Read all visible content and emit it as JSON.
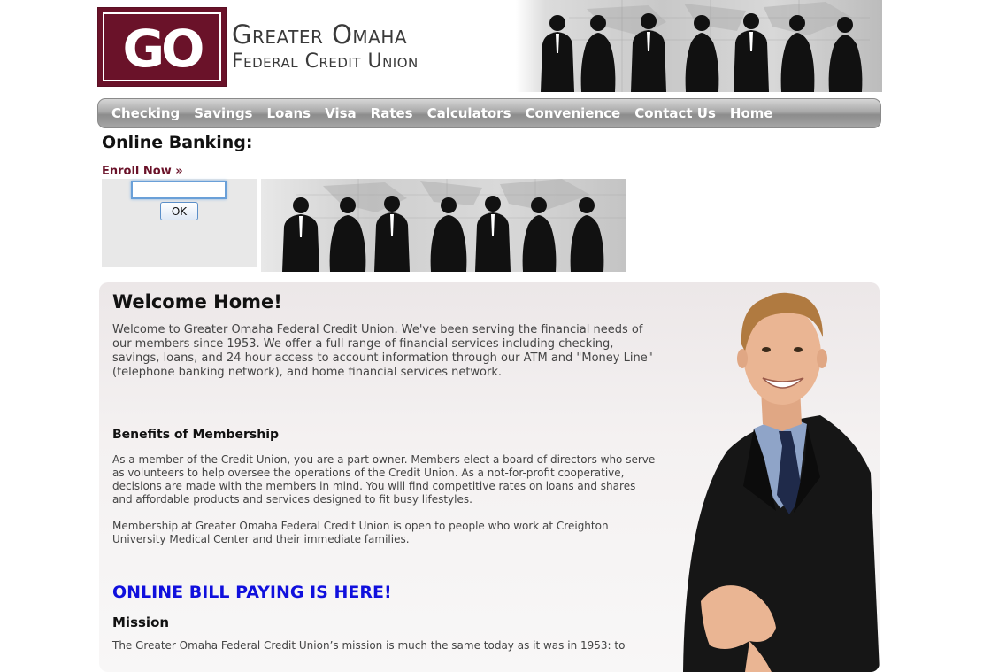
{
  "header": {
    "logo_letters": "GO",
    "brand_line1": "Greater Omaha",
    "brand_line2": "Federal Credit Union"
  },
  "nav": {
    "items": [
      {
        "label": "Checking"
      },
      {
        "label": "Savings"
      },
      {
        "label": "Loans"
      },
      {
        "label": "Visa"
      },
      {
        "label": "Rates"
      },
      {
        "label": "Calculators"
      },
      {
        "label": "Convenience"
      },
      {
        "label": "Contact Us"
      },
      {
        "label": "Home"
      }
    ]
  },
  "online_banking": {
    "title": "Online Banking:",
    "enroll_label": "Enroll Now »",
    "login_value": "",
    "ok_label": "OK"
  },
  "welcome": {
    "heading": "Welcome Home!",
    "intro": "Welcome to Greater Omaha Federal Credit Union. We've been serving the financial needs of our members since 1953. We offer a full range of financial services including checking, savings, loans, and 24 hour access to account information through our ATM and \"Money Line\" (telephone banking network), and home financial services network."
  },
  "benefits": {
    "heading": "Benefits of Membership",
    "para1": "As a member of the Credit Union, you are a part owner. Members elect a board of directors who serve as volunteers to help oversee the operations of the Credit Union. As a not-for-profit cooperative, decisions are made with the members in mind. You will find competitive rates on loans and shares and affordable products and services designed to fit busy lifestyles.",
    "para2": "Membership at Greater Omaha Federal Credit Union is open to people who work at Creighton University Medical Center and their immediate families."
  },
  "bill_pay": {
    "label": "ONLINE BILL PAYING IS HERE!"
  },
  "mission": {
    "heading": "Mission",
    "text": "The Greater Omaha Federal Credit Union’s mission is much the same today as it was in 1953: to"
  },
  "colors": {
    "brand_maroon": "#6a1229",
    "bill_pay_blue": "#1010dd",
    "nav_grey": "#a0a0a0"
  }
}
